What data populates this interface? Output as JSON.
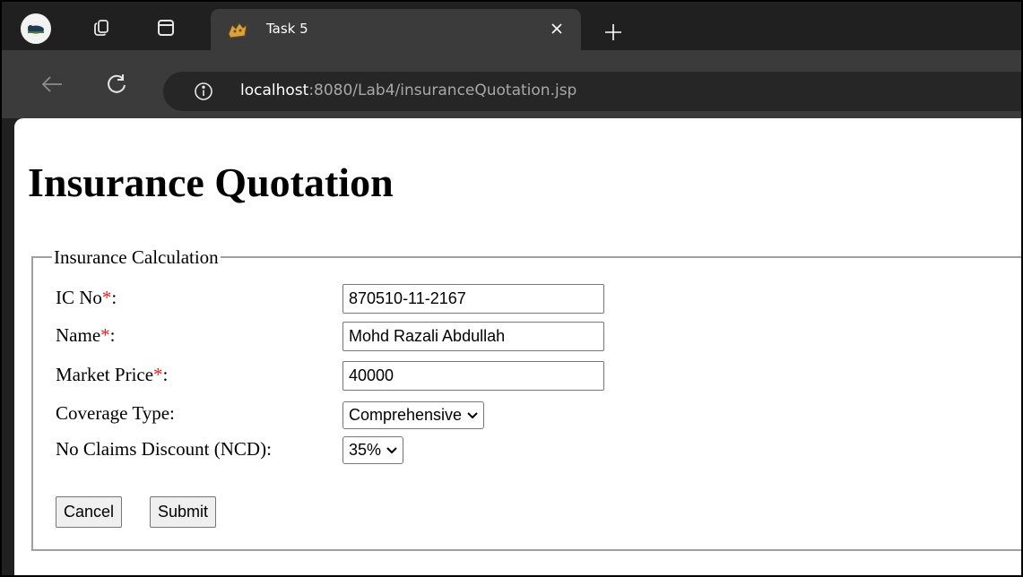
{
  "browser": {
    "tab": {
      "title": "Task 5"
    },
    "url": {
      "host": "localhost",
      "rest": ":8080/Lab4/insuranceQuotation.jsp"
    }
  },
  "page": {
    "title": "Insurance Quotation",
    "form": {
      "legend": "Insurance Calculation",
      "required_marker": "*",
      "fields": {
        "ic_no": {
          "label": "IC No",
          "value": "870510-11-2167"
        },
        "name": {
          "label": "Name",
          "value": "Mohd Razali Abdullah"
        },
        "market_price": {
          "label": "Market Price",
          "value": "40000"
        },
        "coverage_type": {
          "label": "Coverage Type:",
          "selected": "Comprehensive"
        },
        "ncd": {
          "label": "No Claims Discount (NCD):",
          "selected": "35%"
        }
      },
      "buttons": {
        "cancel": "Cancel",
        "submit": "Submit"
      }
    }
  },
  "icons": {
    "profile": "profile-avatar-icon",
    "workspaces": "workspaces-icon",
    "tab_actions": "tab-actions-icon",
    "favicon": "tomcat-favicon-icon",
    "close": "close-icon",
    "new_tab": "plus-icon",
    "back": "back-arrow-icon",
    "refresh": "refresh-icon",
    "info": "info-icon",
    "dropdown": "chevron-down-icon"
  },
  "colors": {
    "chrome_dark": "#202020",
    "chrome_tab": "#3b3b3b",
    "required": "#e02020"
  }
}
